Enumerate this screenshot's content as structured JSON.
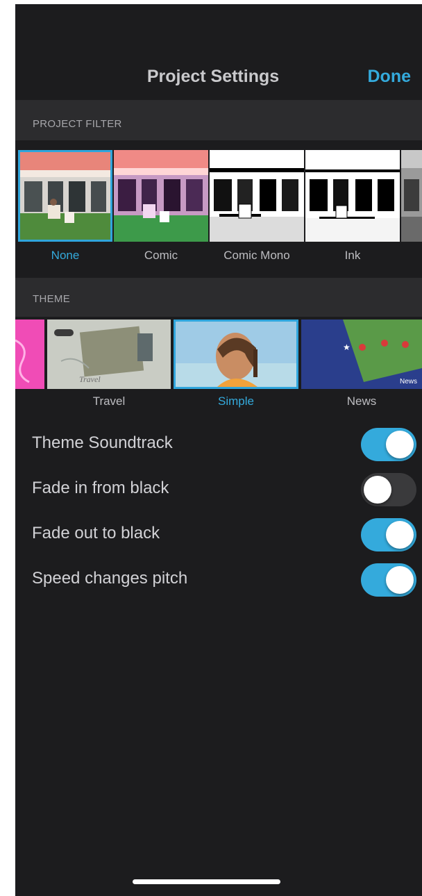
{
  "nav": {
    "title": "Project Settings",
    "done_label": "Done"
  },
  "filter_section": {
    "header": "PROJECT FILTER",
    "items": [
      {
        "label": "None",
        "selected": true
      },
      {
        "label": "Comic",
        "selected": false
      },
      {
        "label": "Comic Mono",
        "selected": false
      },
      {
        "label": "Ink",
        "selected": false
      },
      {
        "label": "",
        "selected": false
      }
    ]
  },
  "theme_section": {
    "header": "THEME",
    "items": [
      {
        "label": "",
        "selected": false
      },
      {
        "label": "Travel",
        "selected": false,
        "thumb_caption": "Travel"
      },
      {
        "label": "Simple",
        "selected": true
      },
      {
        "label": "News",
        "selected": false,
        "thumb_caption": "News"
      }
    ]
  },
  "settings": [
    {
      "label": "Theme Soundtrack",
      "on": true
    },
    {
      "label": "Fade in from black",
      "on": false
    },
    {
      "label": "Fade out to black",
      "on": true
    },
    {
      "label": "Speed changes pitch",
      "on": true
    }
  ],
  "colors": {
    "accent": "#34aadc",
    "background": "#1c1c1e",
    "section": "#2c2c2e"
  }
}
